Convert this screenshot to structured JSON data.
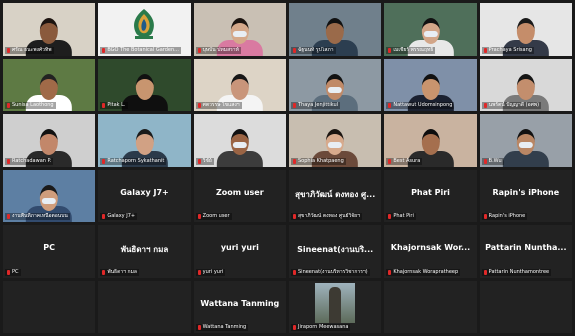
{
  "participants": [
    {
      "label": "ศรัณ ธนะพงศ์วทิพ",
      "kind": "video",
      "bg": "#d8d2c6",
      "skin": "#8a5a3c",
      "shirt": "#1e1e1e",
      "hair": "#1c1410"
    },
    {
      "label": "BGO The Botanical Garden...",
      "kind": "logo",
      "bg": "#f2f2f2"
    },
    {
      "label": "บุษบัน ปทมสราท์",
      "kind": "video",
      "bg": "#c9c0b4",
      "skin": "#d4a88a",
      "shirt": "#d97aa1",
      "hair": "#1c1410",
      "mask": true
    },
    {
      "label": "ฉัฐนนท์ รูปโสภา",
      "kind": "video",
      "bg": "#70808c",
      "skin": "#9a6a4a",
      "shirt": "#2c3e50",
      "hair": "#111"
    },
    {
      "label": "เมเชียร์ พรรณฤทธิ์",
      "kind": "video",
      "bg": "#4f6f5a",
      "skin": "#d2a588",
      "shirt": "#e8e8e8",
      "hair": "#111",
      "mask": true
    },
    {
      "label": "Prachaya Srisang",
      "kind": "video",
      "bg": "#e6e6e6",
      "skin": "#c58d6a",
      "shirt": "#343a48",
      "hair": "#1a1a1a"
    },
    {
      "label": "Sunisa Laothong",
      "kind": "video",
      "bg": "#5e7a44",
      "skin": "#a06a48",
      "shirt": "#ffffff",
      "hair": "#222"
    },
    {
      "label": "Pitak L.",
      "kind": "video",
      "bg": "#2f4a2c",
      "skin": "#c8956f",
      "shirt": "#0f0f0f",
      "hair": "#111"
    },
    {
      "label": "ศตวรรษ ไขแสงฯ",
      "kind": "video",
      "bg": "#ddd4c6",
      "skin": "#c9957a",
      "shirt": "#f4f4f4",
      "hair": "#161616"
    },
    {
      "label": "Thaya Jenjittikul",
      "kind": "video",
      "bg": "#8d99a3",
      "skin": "#c08a68",
      "shirt": "#5c6e7d",
      "hair": "#111",
      "mask": true
    },
    {
      "label": "Nattawut Udomsinpong",
      "kind": "video",
      "bg": "#7f90a8",
      "skin": "#c9946e",
      "shirt": "#1b2130",
      "hair": "#111"
    },
    {
      "label": "นพรัตน์ ปัญญาดี (อศพ)",
      "kind": "video",
      "bg": "#d9d9d9",
      "skin": "#c38e6d",
      "shirt": "#7a7a7a",
      "hair": "#151515"
    },
    {
      "label": "Ratchadawan P.",
      "kind": "video",
      "bg": "#cfcfcf",
      "skin": "#c2876a",
      "shirt": "#2a2a2a",
      "hair": "#111"
    },
    {
      "label": "Ratchaporn Sykathanit",
      "kind": "video",
      "bg": "#8fb5c8",
      "skin": "#d1a184",
      "shirt": "#2b3a4a",
      "hair": "#1a1a1a"
    },
    {
      "label": "วิชัย์",
      "kind": "video",
      "bg": "#dcdcdc",
      "skin": "#9a6444",
      "shirt": "#3c3c3c",
      "hair": "#111",
      "mask": true
    },
    {
      "label": "Sophia Khatpaeng",
      "kind": "video",
      "bg": "#c8beb0",
      "skin": "#d7aa8c",
      "shirt": "#6b4a3a",
      "hair": "#1a1410",
      "mask": true
    },
    {
      "label": "Best Asura",
      "kind": "video",
      "bg": "#c9b3a0",
      "skin": "#a56f4e",
      "shirt": "#2a2a2a",
      "hair": "#0d0d0d"
    },
    {
      "label": "B.Wu",
      "kind": "video",
      "bg": "#98a0a8",
      "skin": "#b98664",
      "shirt": "#323e4c",
      "hair": "#111",
      "mask": true
    },
    {
      "label": "งานพื้นที่ภาคเหนือตอนบน",
      "kind": "video",
      "bg": "#5d7fa3",
      "skin": "#cf9d7c",
      "shirt": "#324b6e",
      "hair": "#1a1a1a",
      "mask": true
    },
    {
      "label": "Galaxy J7+",
      "kind": "name",
      "name": "Galaxy J7+"
    },
    {
      "label": "Zoom user",
      "kind": "name",
      "name": "Zoom user"
    },
    {
      "label": "สุขาภิวัฒน์ ตงทอง ศูนย์วิจัยฯ",
      "kind": "name",
      "name": "สุขาภิวัฒน์ ตงทอง ศู..."
    },
    {
      "label": "Phat Piri",
      "kind": "name",
      "name": "Phat Piri"
    },
    {
      "label": "Rapin's iPhone",
      "kind": "name",
      "name": "Rapin's iPhone"
    },
    {
      "label": "PC",
      "kind": "name",
      "name": "PC"
    },
    {
      "label": "พันธิดาฯ กมล",
      "kind": "name",
      "name": "พันธิดาฯ กมล"
    },
    {
      "label": "yuri yuri",
      "kind": "name",
      "name": "yuri yuri"
    },
    {
      "label": "Sineenat(งานบริหารวิชาการฯ)",
      "kind": "name",
      "name": "Sineenat(งานบริ..."
    },
    {
      "label": "Khajornsak Worapratheep",
      "kind": "name",
      "name": "Khajornsak Wor..."
    },
    {
      "label": "Pattarin Nunthamontree",
      "kind": "name",
      "name": "Pattarin Nuntha..."
    },
    {
      "label": "",
      "kind": "blank"
    },
    {
      "label": "",
      "kind": "blank"
    },
    {
      "label": "Wattana Tanming",
      "kind": "name",
      "name": "Wattana Tanming"
    },
    {
      "label": "Jiraporn Meewasana",
      "kind": "photo",
      "bg": "#b9c4c9"
    },
    {
      "label": "",
      "kind": "blank"
    },
    {
      "label": "",
      "kind": "blank"
    }
  ],
  "colors": {
    "mic_muted": "#e02828",
    "name_tile_bg": "#222222",
    "label_text": "#ffffff"
  },
  "icons": {
    "mic": "mic-muted-icon"
  }
}
